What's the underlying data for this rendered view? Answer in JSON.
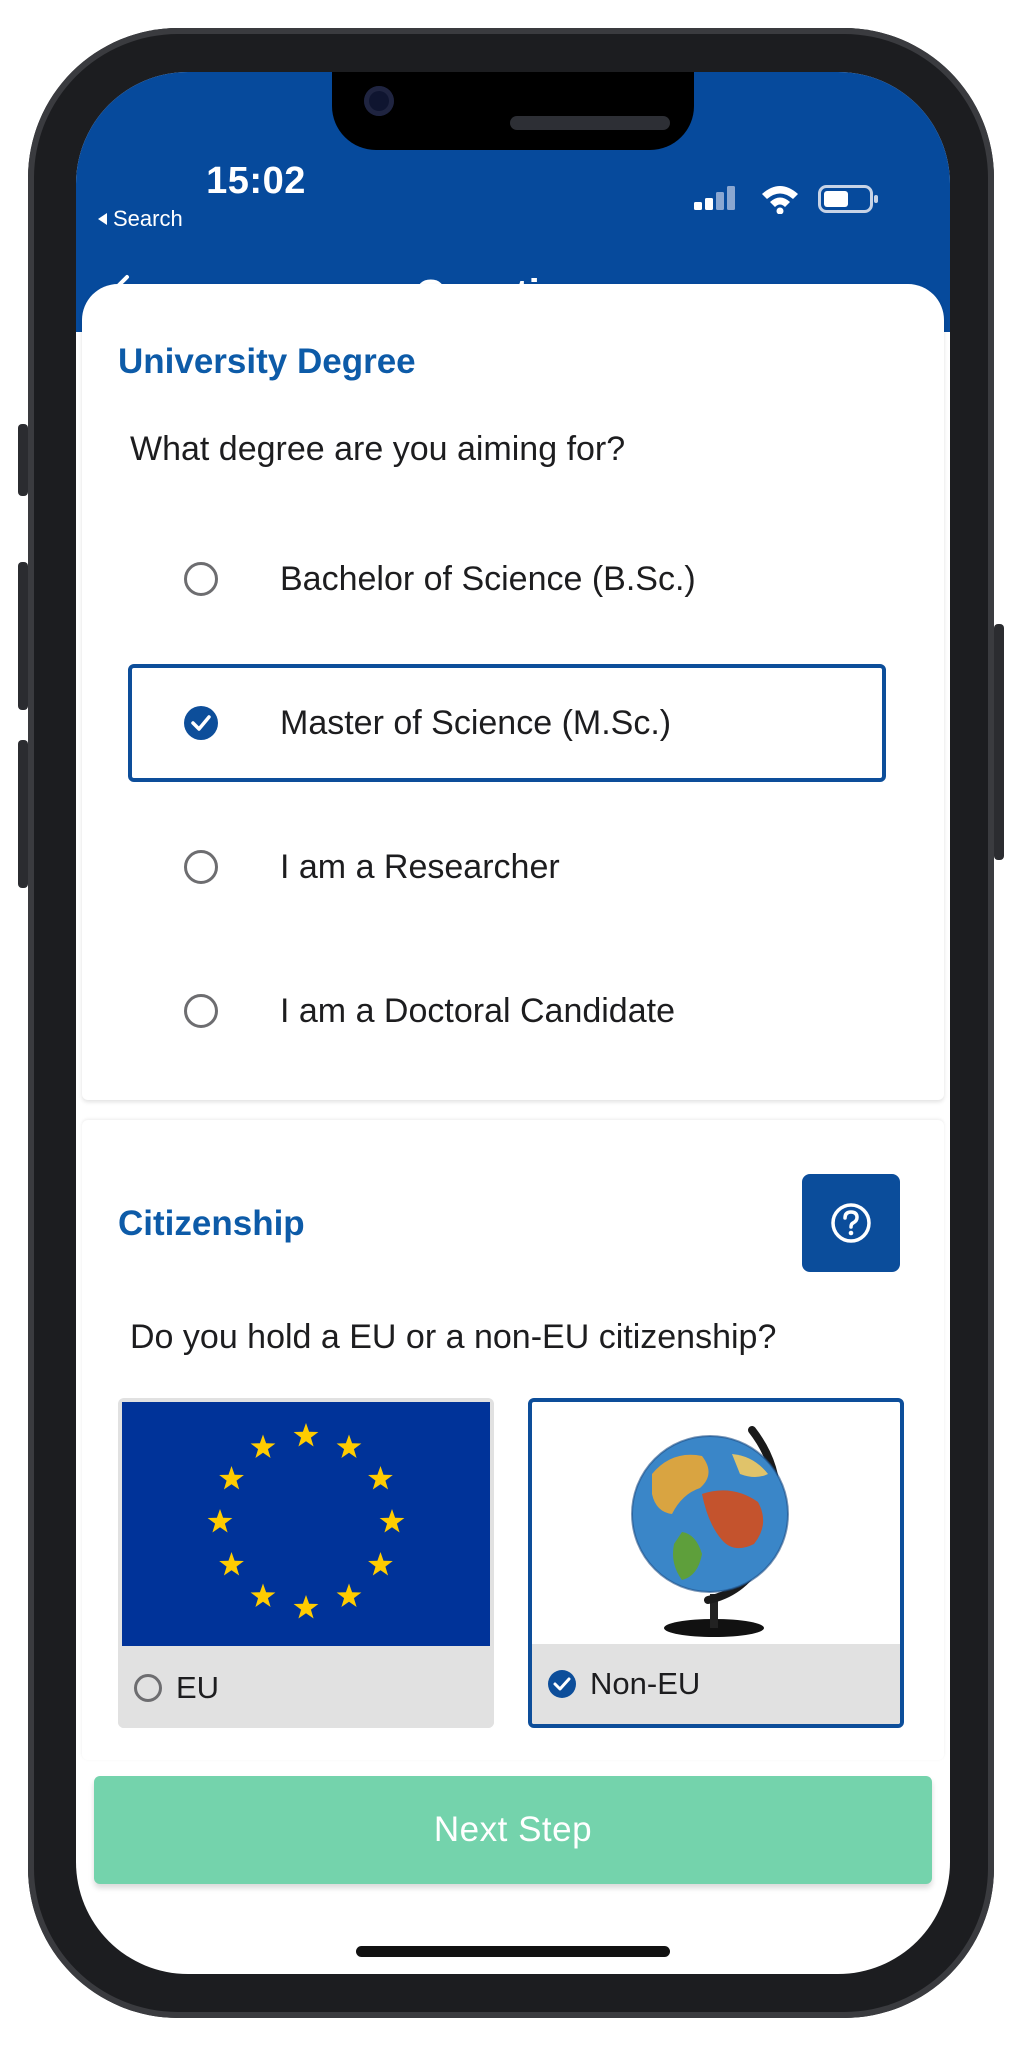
{
  "status_bar": {
    "time": "15:02",
    "back_app": "Search"
  },
  "nav": {
    "title": "Questions"
  },
  "degree_section": {
    "title": "University Degree",
    "question": "What degree are you aiming for?",
    "options": [
      {
        "label": "Bachelor of Science (B.Sc.)",
        "selected": false
      },
      {
        "label": "Master of Science (M.Sc.)",
        "selected": true
      },
      {
        "label": "I am a Researcher",
        "selected": false
      },
      {
        "label": "I am a Doctoral Candidate",
        "selected": false
      }
    ]
  },
  "citizenship_section": {
    "title": "Citizenship",
    "question": "Do you hold a EU or a non-EU citizenship?",
    "choices": [
      {
        "label": "EU",
        "selected": false,
        "image": "eu-flag"
      },
      {
        "label": "Non-EU",
        "selected": true,
        "image": "globe"
      }
    ]
  },
  "next_button": {
    "label": "Next Step"
  },
  "colors": {
    "brand_blue": "#064a9c",
    "accent_green": "#74d3ac",
    "eu_blue": "#003399",
    "eu_star": "#ffcc00"
  }
}
